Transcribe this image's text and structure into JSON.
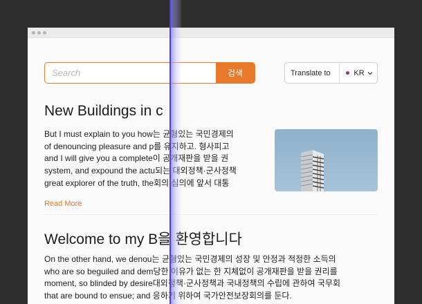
{
  "search": {
    "placeholder": "Search",
    "button_label": "검색"
  },
  "translate": {
    "label": "Translate to",
    "language": "KR",
    "flag_icon": "korea-flag-icon",
    "chevron_icon": "chevron-down-icon"
  },
  "articles": [
    {
      "title": "New Buildings in c",
      "lines": [
        "But I must explain to you how는 균형있는 국민경제의",
        "of denouncing pleasure and p를 유지하고. 형사피고",
        "and I will give you a complete이 공개재판을 받을 권",
        "system, and expound the actu되는 대외정책·군사정책",
        "great explorer of the truth, the회의 심의에 앞서 대통"
      ],
      "read_more": "Read More"
    },
    {
      "title": "Welcome to my B을 환영합니다",
      "lines": [
        "On the other hand, we denou는 균형있는 국민경제의 성장 및 안정과 적정한 소득의",
        "who are so beguiled and dem당한 이유가 없는 한 지체없이 공개재판을 받을 권리를",
        "moment, so blinded by desire대외정책·군사정책과 국내정책의 수립에 관하여 국무회",
        "that are bound to ensue; and 응하기 위하여 국가안전보장회의를 둔다."
      ]
    }
  ],
  "colors": {
    "accent": "#e8792a",
    "divider": "#5a50e8",
    "background": "#2e2e2e",
    "page": "#fafafa"
  }
}
